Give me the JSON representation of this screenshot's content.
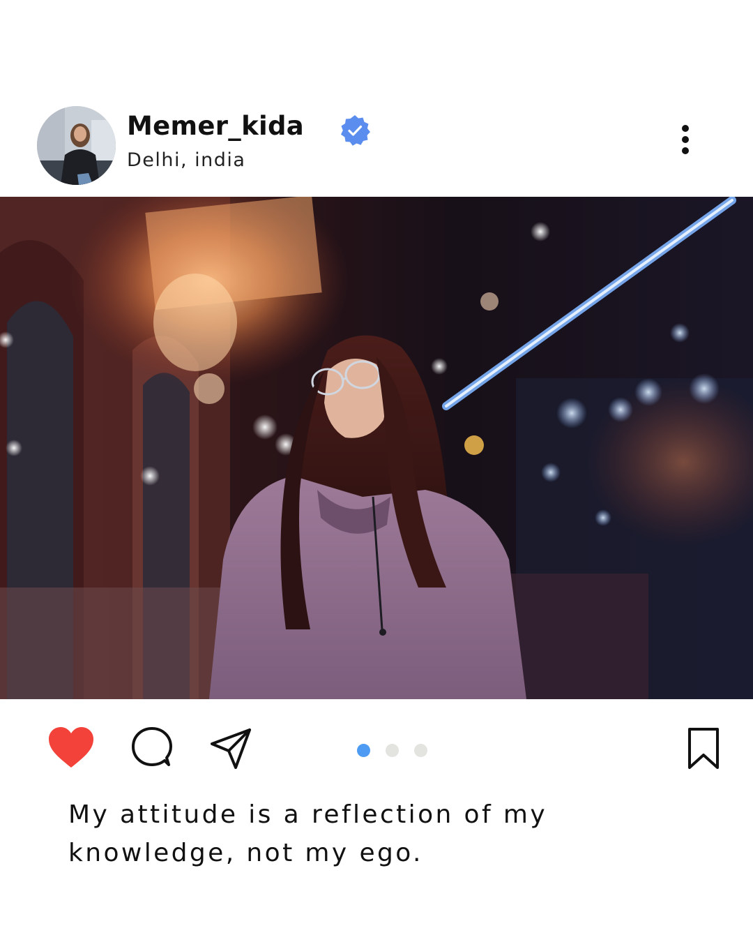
{
  "post": {
    "username": "Memer_kida",
    "location": "Delhi, india",
    "verified": true,
    "caption": "My attitude is a reflection of my knowledge, not my ego.",
    "liked": true,
    "carousel": {
      "total": 3,
      "active_index": 0
    }
  },
  "icons": {
    "verified": "verified-badge-icon",
    "more": "more-vertical-icon",
    "like": "heart-icon",
    "comment": "comment-bubble-icon",
    "share": "paper-plane-icon",
    "save": "bookmark-icon"
  },
  "colors": {
    "like": "#f2423a",
    "verified": "#5b8def",
    "dot_active": "#4d9bf2",
    "dot_inactive": "#e3e4e0"
  }
}
